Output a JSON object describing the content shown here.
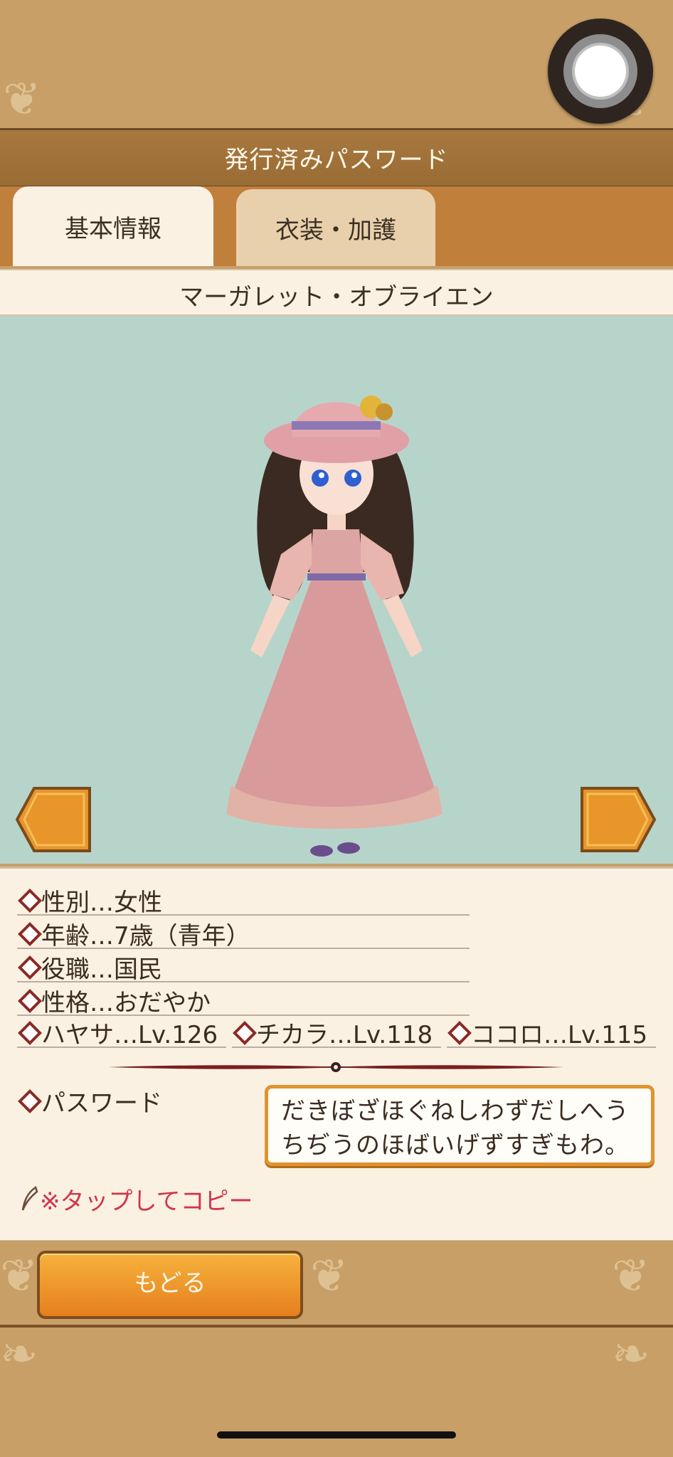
{
  "header": {
    "title": "発行済みパスワード"
  },
  "tabs": [
    {
      "label": "基本情報",
      "active": true
    },
    {
      "label": "衣装・加護",
      "active": false
    }
  ],
  "character": {
    "name": "マーガレット・オブライエン"
  },
  "info": {
    "gender": "性別…女性",
    "age": "年齢…7歳（青年）",
    "role": "役職…国民",
    "personality": "性格…おだやか",
    "stats": {
      "speed": "ハヤサ…Lv.126",
      "power": "チカラ…Lv.118",
      "heart": "ココロ…Lv.115"
    }
  },
  "password": {
    "label": "パスワード",
    "value_line1": "だきぼざほぐねしわずだしへう",
    "value_line2": "ちぢうのほばいげずすぎもわ。",
    "copy_hint": "※タップしてコピー"
  },
  "buttons": {
    "back": "もどる"
  },
  "colors": {
    "accent": "#e67f1e",
    "panel": "#fbf1e3",
    "scene": "#b7d4ca",
    "frame": "#c79f67",
    "hint": "#d1354a"
  },
  "icons": [
    "home-button-icon",
    "arrow-left-icon",
    "arrow-right-icon",
    "diamond-bullet-icon",
    "quill-icon"
  ]
}
